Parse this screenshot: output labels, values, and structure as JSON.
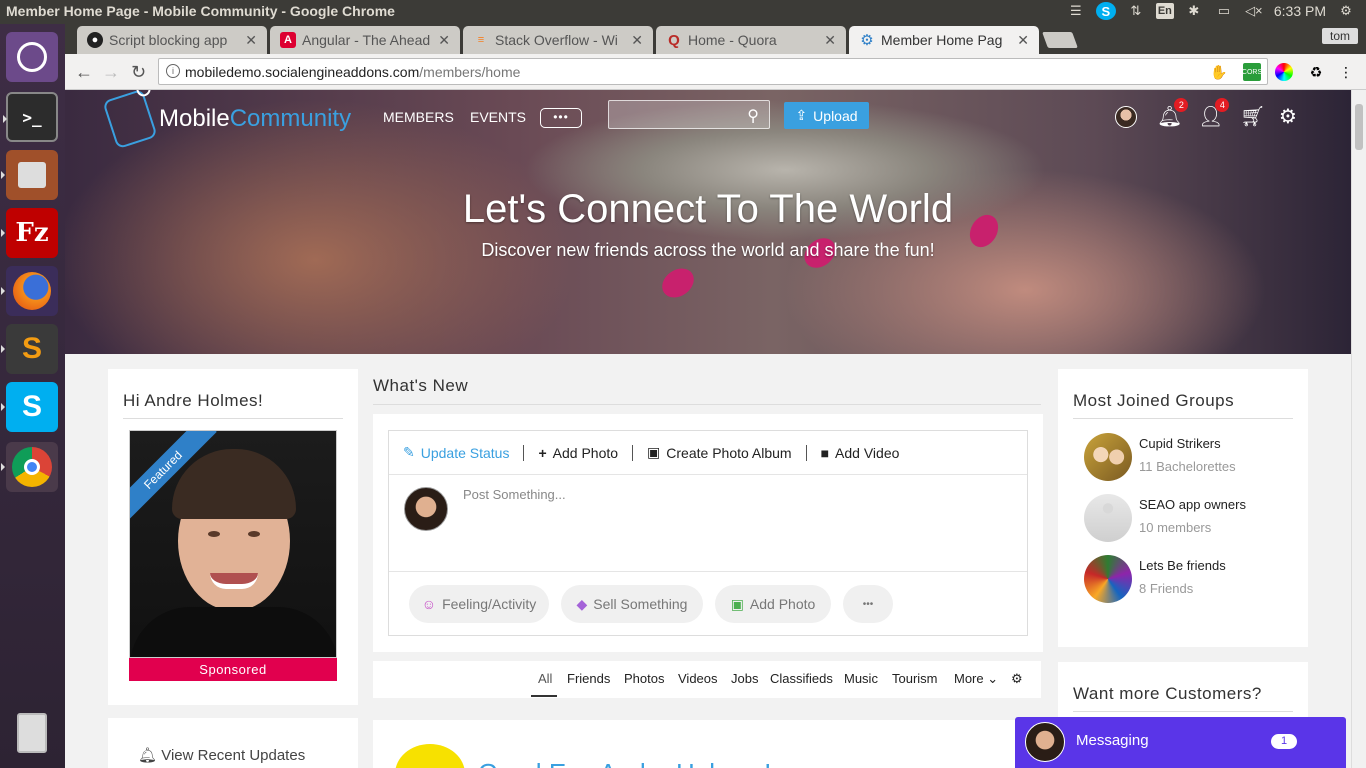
{
  "os": {
    "window_title": "Member Home Page - Mobile Community - Google Chrome",
    "keyboard": "En",
    "clock": "6:33 PM"
  },
  "launcher": {
    "items": [
      "Ubuntu Dash",
      "Terminal",
      "Files",
      "FileZilla",
      "Firefox",
      "Sublime Text",
      "Skype",
      "Chrome",
      "Trash"
    ]
  },
  "browser": {
    "tabs": [
      {
        "label": "Script blocking app",
        "icon": "github-icon"
      },
      {
        "label": "Angular - The Ahead",
        "icon": "angular-icon"
      },
      {
        "label": "Stack Overflow - Wi",
        "icon": "stackoverflow-icon"
      },
      {
        "label": "Home - Quora",
        "icon": "quora-icon"
      },
      {
        "label": "Member Home Pag",
        "icon": "gear-icon"
      }
    ],
    "tab_close": "✕",
    "user": "tom",
    "url_host": "mobiledemo.socialengineaddons.com",
    "url_path": "/members/home"
  },
  "site": {
    "logo_part1": "Mobile",
    "logo_part2": "Community",
    "nav": [
      "MEMBERS",
      "EVENTS"
    ],
    "more_dots": "•••",
    "upload_label": "Upload",
    "notifications_badge": "2",
    "friend_requests_badge": "4",
    "hero_title": "Let's Connect To The World",
    "hero_subtitle": "Discover new friends across the world and share the fun!"
  },
  "left": {
    "greeting": "Hi Andre Holmes!",
    "ribbon": "Featured",
    "sponsored": "Sponsored",
    "recent_updates": "View Recent Updates"
  },
  "feed": {
    "whats_new": "What's New",
    "composer_tabs": [
      "Update Status",
      "Add Photo",
      "Create Photo Album",
      "Add Video"
    ],
    "placeholder": "Post Something...",
    "pills": [
      "Feeling/Activity",
      "Sell Something",
      "Add Photo",
      "•••"
    ],
    "filters": [
      "All",
      "Friends",
      "Photos",
      "Videos",
      "Jobs",
      "Classifieds",
      "Music",
      "Tourism",
      "More"
    ],
    "post_title": "Good Eve Andre Holmes!"
  },
  "right": {
    "groups_title": "Most Joined Groups",
    "groups": [
      {
        "name": "Cupid Strikers",
        "meta": "11 Bachelorettes"
      },
      {
        "name": "SEAO app owners",
        "meta": "10 members"
      },
      {
        "name": "Lets Be friends",
        "meta": "8 Friends"
      }
    ],
    "customers_title": "Want more Customers?"
  },
  "messaging": {
    "label": "Messaging",
    "count": "1"
  },
  "colors": {
    "accent": "#3aa0e0",
    "sponsored": "#e1004e",
    "messaging": "#5a35e8",
    "badge": "#e31c23"
  }
}
